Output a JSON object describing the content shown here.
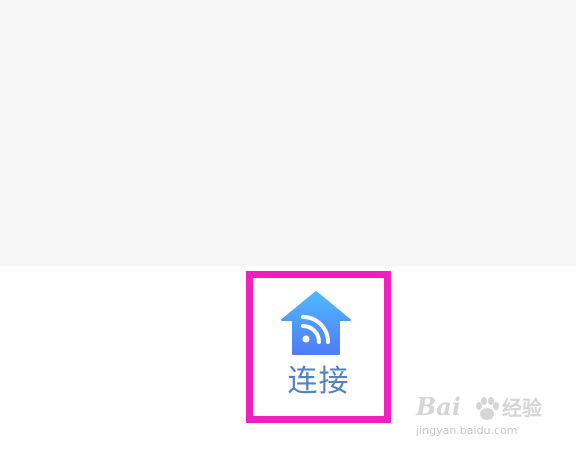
{
  "tab": {
    "label": "连接",
    "icon": "home-wifi-icon",
    "label_color": "#4f82c9"
  },
  "highlight": {
    "color": "#f01fc0"
  },
  "colors": {
    "icon_gradient_top": "#4fb8ff",
    "icon_gradient_bottom": "#4f7df5",
    "content_background": "#f6f6f6"
  },
  "watermark": {
    "logo_text": "Bai",
    "brand_text": "经验",
    "url": "jingyan.baidu.com"
  }
}
